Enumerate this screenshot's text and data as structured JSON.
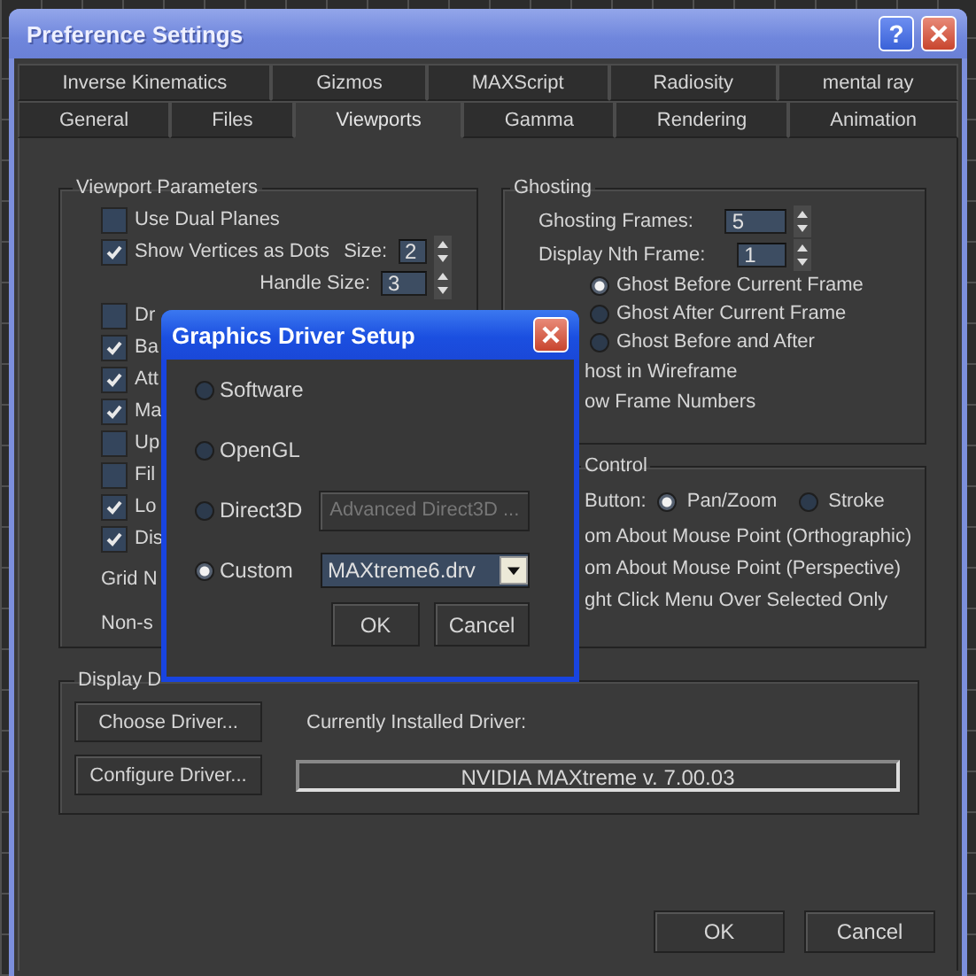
{
  "window": {
    "title": "Preference Settings",
    "buttons": [
      {
        "kind": "help",
        "label": "?"
      },
      {
        "kind": "close"
      }
    ]
  },
  "tab_rows": [
    {
      "tabs": [
        {
          "label": "Inverse Kinematics",
          "selected": false
        },
        {
          "label": "Gizmos",
          "selected": false
        },
        {
          "label": "MAXScript",
          "selected": false
        },
        {
          "label": "Radiosity",
          "selected": false
        },
        {
          "label": "mental ray",
          "selected": false
        }
      ]
    },
    {
      "tabs": [
        {
          "label": "General",
          "selected": false
        },
        {
          "label": "Files",
          "selected": false
        },
        {
          "label": "Viewports",
          "selected": true
        },
        {
          "label": "Gamma",
          "selected": false
        },
        {
          "label": "Rendering",
          "selected": false
        },
        {
          "label": "Animation",
          "selected": false
        }
      ]
    }
  ],
  "viewport_parameters": {
    "title": "Viewport Parameters",
    "rows": [
      {
        "kind": "checkbox",
        "label": "Use Dual Planes",
        "checked": false
      },
      {
        "kind": "checkbox",
        "label": "Show Vertices as Dots",
        "checked": true,
        "spinner": {
          "label": "Size:",
          "value": "2"
        }
      },
      {
        "kind": "spinner",
        "label": "Handle Size:",
        "value": "3"
      },
      {
        "kind": "checkbox",
        "label": "Dr",
        "checked": false
      },
      {
        "kind": "checkbox",
        "label": "Ba",
        "checked": true
      },
      {
        "kind": "checkbox",
        "label": "Att",
        "checked": true
      },
      {
        "kind": "checkbox",
        "label": "Ma",
        "checked": true
      },
      {
        "kind": "checkbox",
        "label": "Up",
        "checked": false
      },
      {
        "kind": "checkbox",
        "label": "Fil",
        "checked": false
      },
      {
        "kind": "checkbox",
        "label": "Lo",
        "checked": true
      },
      {
        "kind": "checkbox",
        "label": "Dis",
        "checked": true
      },
      {
        "kind": "text",
        "label": "Grid N"
      },
      {
        "kind": "text",
        "label": "Non-s"
      }
    ]
  },
  "ghosting": {
    "title": "Ghosting",
    "spinners": [
      {
        "label": "Ghosting Frames:",
        "value": "5"
      },
      {
        "label": "Display Nth Frame:",
        "value": "1"
      }
    ],
    "radios": [
      {
        "label": "Ghost Before Current Frame",
        "selected": true
      },
      {
        "label": "Ghost After Current Frame",
        "selected": false
      },
      {
        "label": "Ghost Before and After",
        "selected": false
      }
    ],
    "lines": [
      "host in Wireframe",
      "ow Frame Numbers"
    ]
  },
  "control": {
    "title": "Control",
    "mode_label": "Button:",
    "radios": [
      {
        "label": "Pan/Zoom",
        "selected": true
      },
      {
        "label": "Stroke",
        "selected": false
      }
    ],
    "lines": [
      "om About Mouse Point (Orthographic)",
      "om About Mouse Point (Perspective)",
      "ght Click Menu Over Selected Only"
    ]
  },
  "display_driver": {
    "title": "Display D",
    "buttons": [
      "Choose Driver...",
      "Configure Driver..."
    ],
    "installed_label": "Currently Installed Driver:",
    "installed_value": "NVIDIA MAXtreme v. 7.00.03"
  },
  "footer_buttons": [
    "OK",
    "Cancel"
  ],
  "dialog": {
    "title": "Graphics Driver Setup",
    "options": [
      {
        "label": "Software",
        "selected": false
      },
      {
        "label": "OpenGL",
        "selected": false
      },
      {
        "label": "Direct3D",
        "selected": false,
        "button": {
          "label": "Advanced Direct3D ...",
          "disabled": true
        }
      },
      {
        "label": "Custom",
        "selected": true,
        "dropdown": {
          "value": "MAXtreme6.drv"
        }
      }
    ],
    "buttons": [
      "OK",
      "Cancel"
    ]
  }
}
